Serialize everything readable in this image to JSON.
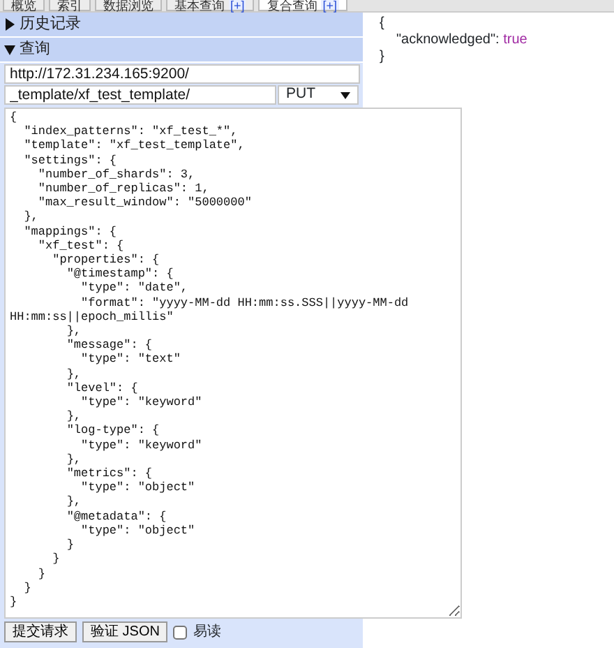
{
  "tabs": [
    {
      "label": "概览",
      "selected": false
    },
    {
      "label": "索引",
      "selected": false
    },
    {
      "label": "数据浏览",
      "selected": false
    },
    {
      "label": "基本查询",
      "plus": "[+]",
      "selected": false
    },
    {
      "label": "复合查询",
      "plus": "[+]",
      "selected": true
    }
  ],
  "sections": [
    {
      "title": "历史记录",
      "expanded": false
    },
    {
      "title": "查询",
      "expanded": true
    }
  ],
  "query": {
    "url": "http://172.31.234.165:9200/",
    "path": "_template/xf_test_template/",
    "method": "PUT",
    "body": "{\n  \"index_patterns\": \"xf_test_*\",\n  \"template\": \"xf_test_template\",\n  \"settings\": {\n    \"number_of_shards\": 3,\n    \"number_of_replicas\": 1,\n    \"max_result_window\": \"5000000\"\n  },\n  \"mappings\": {\n    \"xf_test\": {\n      \"properties\": {\n        \"@timestamp\": {\n          \"type\": \"date\",\n          \"format\": \"yyyy-MM-dd HH:mm:ss.SSS||yyyy-MM-dd HH:mm:ss||epoch_millis\"\n        },\n        \"message\": {\n          \"type\": \"text\"\n        },\n        \"level\": {\n          \"type\": \"keyword\"\n        },\n        \"log-type\": {\n          \"type\": \"keyword\"\n        },\n        \"metrics\": {\n          \"type\": \"object\"\n        },\n        \"@metadata\": {\n          \"type\": \"object\"\n        }\n      }\n    }\n  }\n}",
    "buttons": [
      "提交请求",
      "验证 JSON"
    ],
    "pretty": {
      "label": "易读",
      "checked": false
    }
  },
  "response": {
    "open": "{",
    "key": "\"acknowledged\":",
    "value": "true",
    "close": "}"
  }
}
